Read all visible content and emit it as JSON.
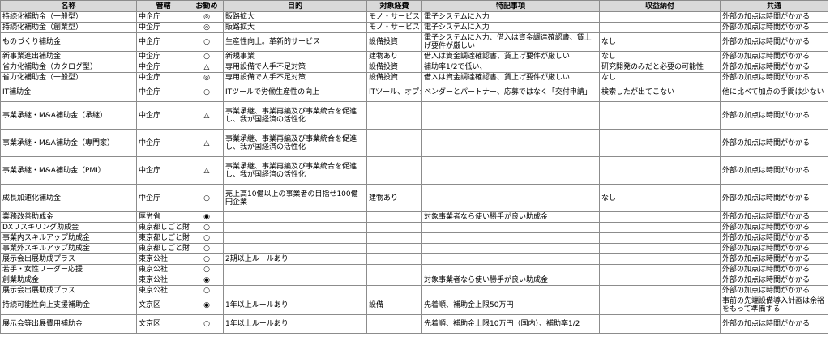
{
  "headers": [
    "名称",
    "管轄",
    "お勧め",
    "目的",
    "対象経費",
    "特記事項",
    "収益納付",
    "共通"
  ],
  "rows": [
    {
      "h": 1,
      "name": "持続化補助金（一般型）",
      "agency": "中企庁",
      "rec": "◎",
      "purpose": "販路拡大",
      "cost": "モノ・サービス",
      "notes": "電子システムに入力",
      "revenue": "",
      "common": "外部の加点は時間がかかる"
    },
    {
      "h": 1,
      "name": "持続化補助金（創業型）",
      "agency": "中企庁",
      "rec": "◎",
      "purpose": "販路拡大",
      "cost": "モノ・サービス",
      "notes": "電子システムに入力",
      "revenue": "",
      "common": "外部の加点は時間がかかる"
    },
    {
      "h": 2,
      "name": "ものづくり補助金",
      "agency": "中企庁",
      "rec": "○",
      "purpose": "生産性向上。革新的サービス",
      "cost": "設備投資",
      "notes": "電子システムに入力、借入は資金調達確認書、賃上げ要件が厳しい",
      "revenue": "なし",
      "common": "外部の加点は時間がかかる"
    },
    {
      "h": 1,
      "name": "新事業進出補助金",
      "agency": "中企庁",
      "rec": "○",
      "purpose": "新規事業",
      "cost": "建物あり",
      "notes": "借入は資金調達確認書、賃上げ要件が厳しい",
      "revenue": "なし",
      "common": "外部の加点は時間がかかる"
    },
    {
      "h": 1,
      "name": "省力化補助金（カタログ型）",
      "agency": "中企庁",
      "rec": "△",
      "purpose": "専用設備で人手不足対策",
      "cost": "設備投資",
      "notes": "補助率1/2で低い、",
      "revenue": "研究開発のみだと必要の可能性",
      "common": "外部の加点は時間がかかる"
    },
    {
      "h": 1,
      "name": "省力化補助金（一般型）",
      "agency": "中企庁",
      "rec": "◎",
      "purpose": "専用設備で人手不足対策",
      "cost": "設備投資",
      "notes": "借入は資金調達確認書、賃上げ要件が厳しい",
      "revenue": "なし",
      "common": "外部の加点は時間がかかる"
    },
    {
      "h": 2,
      "name": "IT補助金",
      "agency": "中企庁",
      "rec": "○",
      "purpose": "ITツールで労働生産性の向上",
      "cost": "ITツール、オプション",
      "notes": "ベンダーとパートナー、応募ではなく「交付申請」",
      "revenue": "検索したが出てこない",
      "common": "他に比べて加点の手間は少ない"
    },
    {
      "h": 3,
      "name": "事業承継・M&A補助金（承継）",
      "agency": "中企庁",
      "rec": "△",
      "purpose": "事業承継、事業再編及び事業統合を促進し、我が国経済の活性化",
      "cost": "",
      "notes": "",
      "revenue": "",
      "common": "外部の加点は時間がかかる"
    },
    {
      "h": 3,
      "name": "事業承継・M&A補助金（専門家）",
      "agency": "中企庁",
      "rec": "△",
      "purpose": "事業承継、事業再編及び事業統合を促進し、我が国経済の活性化",
      "cost": "",
      "notes": "",
      "revenue": "",
      "common": "外部の加点は時間がかかる"
    },
    {
      "h": 3,
      "name": "事業承継・M&A補助金（PMI）",
      "agency": "中企庁",
      "rec": "△",
      "purpose": "事業承継、事業再編及び事業統合を促進し、我が国経済の活性化",
      "cost": "",
      "notes": "",
      "revenue": "",
      "common": "外部の加点は時間がかかる"
    },
    {
      "h": 3,
      "name": "成長加速化補助金",
      "agency": "中企庁",
      "rec": "○",
      "purpose": "売上高10億以上の事業者の目指せ100億円企業",
      "cost": "建物あり",
      "notes": "",
      "revenue": "なし",
      "common": "外部の加点は時間がかかる"
    },
    {
      "h": 1,
      "name": "業務改善助成金",
      "agency": "厚労省",
      "rec": "◉",
      "purpose": "",
      "cost": "",
      "notes": "対象事業者なら使い勝手が良い助成金",
      "revenue": "",
      "common": "外部の加点は時間がかかる"
    },
    {
      "h": 1,
      "name": "DXリスキリング助成金",
      "agency": "東京都しごと財団",
      "rec": "○",
      "purpose": "",
      "cost": "",
      "notes": "",
      "revenue": "",
      "common": "外部の加点は時間がかかる"
    },
    {
      "h": 1,
      "name": "事業内スキルアップ助成金",
      "agency": "東京都しごと財団",
      "rec": "○",
      "purpose": "",
      "cost": "",
      "notes": "",
      "revenue": "",
      "common": "外部の加点は時間がかかる"
    },
    {
      "h": 1,
      "name": "事業外スキルアップ助成金",
      "agency": "東京都しごと財団",
      "rec": "○",
      "purpose": "",
      "cost": "",
      "notes": "",
      "revenue": "",
      "common": "外部の加点は時間がかかる"
    },
    {
      "h": 1,
      "name": "展示会出展助成プラス",
      "agency": "東京公社",
      "rec": "○",
      "purpose": "2期以上ルールあり",
      "cost": "",
      "notes": "",
      "revenue": "",
      "common": "外部の加点は時間がかかる"
    },
    {
      "h": 1,
      "name": "若手・女性リーダー応援",
      "agency": "東京公社",
      "rec": "○",
      "purpose": "",
      "cost": "",
      "notes": "",
      "revenue": "",
      "common": "外部の加点は時間がかかる"
    },
    {
      "h": 1,
      "name": "創業助成金",
      "agency": "東京公社",
      "rec": "◉",
      "purpose": "",
      "cost": "",
      "notes": "対象事業者なら使い勝手が良い助成金",
      "revenue": "",
      "common": "外部の加点は時間がかかる"
    },
    {
      "h": 1,
      "name": "展示会出展助成プラス",
      "agency": "東京公社",
      "rec": "○",
      "purpose": "",
      "cost": "",
      "notes": "",
      "revenue": "",
      "common": "外部の加点は時間がかかる"
    },
    {
      "h": 2,
      "name": "持続可能性向上支援補助金",
      "agency": "文京区",
      "rec": "◉",
      "purpose": "1年以上ルールあり",
      "cost": "設備",
      "notes": "先着順、補助金上限50万円",
      "revenue": "",
      "common": "事前の先端設備導入計画は余裕をもって準備する"
    },
    {
      "h": 2,
      "name": "展示会等出展費用補助金",
      "agency": "文京区",
      "rec": "○",
      "purpose": "1年以上ルールあり",
      "cost": "",
      "notes": "先着順、補助金上限10万円（国内）、補助率1/2",
      "revenue": "",
      "common": "外部の加点は時間がかかる"
    }
  ]
}
